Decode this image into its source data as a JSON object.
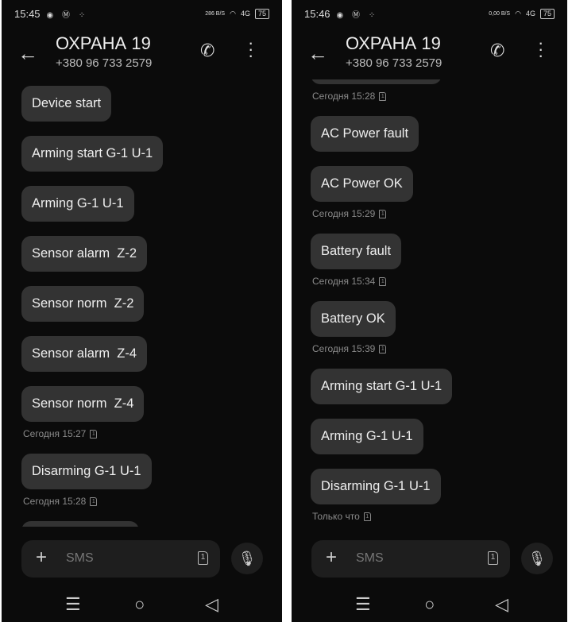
{
  "screens": [
    {
      "status": {
        "time": "15:45",
        "speed": "286 B/S",
        "network": "4G",
        "battery": "75"
      },
      "header": {
        "title": "ОХРАНА 19",
        "phone": "+380 96 733 2579"
      },
      "messages": [
        {
          "text": "Device start"
        },
        {
          "text": "Arming start G-1 U-1"
        },
        {
          "text": "Arming G-1 U-1"
        },
        {
          "text": "Sensor alarm  Z-2"
        },
        {
          "text": "Sensor norm  Z-2"
        },
        {
          "text": "Sensor alarm  Z-4"
        },
        {
          "text": "Sensor norm  Z-4",
          "time": "Сегодня 15:27"
        },
        {
          "text": "Disarming G-1 U-1",
          "time": "Сегодня 15:28"
        },
        {
          "text": ""
        }
      ],
      "compose": {
        "placeholder": "SMS",
        "sim": "1"
      }
    },
    {
      "status": {
        "time": "15:46",
        "speed": "0,00 B/S",
        "network": "4G",
        "battery": "75"
      },
      "header": {
        "title": "ОХРАНА 19",
        "phone": "+380 96 733 2579"
      },
      "messages": [
        {
          "text": "",
          "time": "Сегодня 15:28"
        },
        {
          "text": "AC Power fault"
        },
        {
          "text": "AC Power OK",
          "time": "Сегодня 15:29"
        },
        {
          "text": "Battery fault",
          "time": "Сегодня 15:34"
        },
        {
          "text": "Battery OK",
          "time": "Сегодня 15:39"
        },
        {
          "text": "Arming start G-1 U-1"
        },
        {
          "text": "Arming G-1 U-1"
        },
        {
          "text": "Disarming G-1 U-1",
          "time": "Только что"
        }
      ],
      "compose": {
        "placeholder": "SMS",
        "sim": "1"
      }
    }
  ],
  "colors": {
    "background": "#0b0b0b",
    "bubble": "#333333",
    "timestamp": "#8a8a8a"
  }
}
